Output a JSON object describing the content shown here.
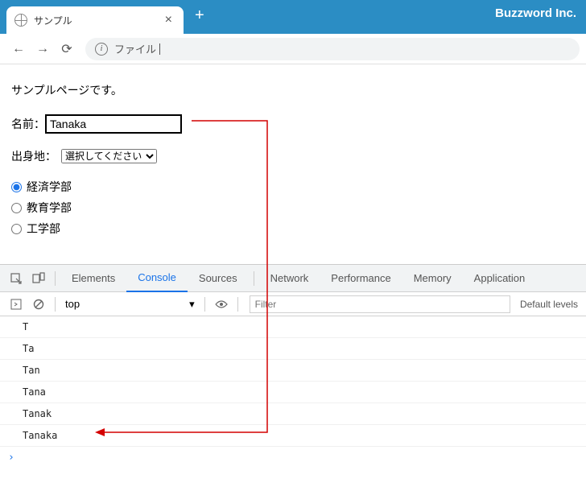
{
  "titlebar": {
    "tab_title": "サンプル",
    "brand": "Buzzword Inc."
  },
  "toolbar": {
    "address_label": "ファイル",
    "info_glyph": "i"
  },
  "page": {
    "intro": "サンプルページです。",
    "name_label": "名前：",
    "name_value": "Tanaka",
    "origin_label": "出身地：",
    "origin_placeholder": "選択してください",
    "radios": {
      "r1": "経済学部",
      "r2": "教育学部",
      "r3": "工学部"
    }
  },
  "devtools": {
    "tabs": {
      "elements": "Elements",
      "console": "Console",
      "sources": "Sources",
      "network": "Network",
      "performance": "Performance",
      "memory": "Memory",
      "application": "Application"
    },
    "context": "top",
    "filter_placeholder": "Filter",
    "levels": "Default levels",
    "logs": {
      "l1": "T",
      "l2": "Ta",
      "l3": "Tan",
      "l4": "Tana",
      "l5": "Tanak",
      "l6": "Tanaka"
    },
    "prompt_glyph": "›"
  },
  "annotation_color": "#d40000"
}
